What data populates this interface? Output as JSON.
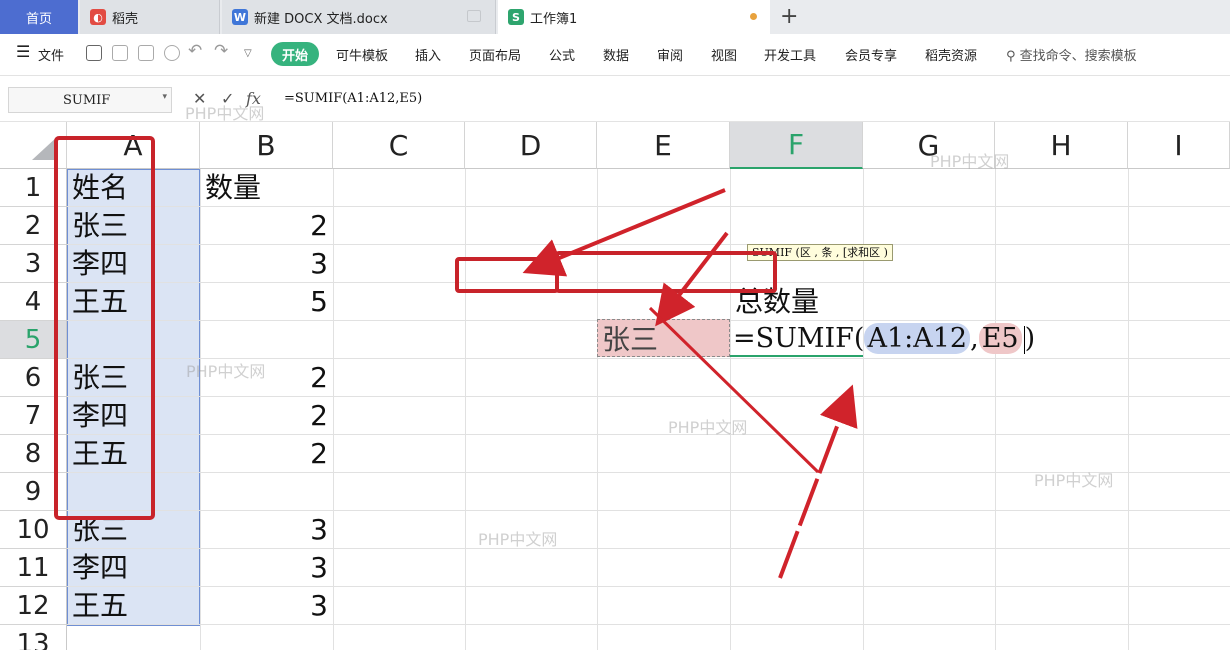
{
  "tabs": {
    "home": "首页",
    "daoke": "稻壳",
    "doc": "新建 DOCX 文档.docx",
    "workbook": "工作簿1"
  },
  "menu": {
    "file": "文件",
    "start": "开始",
    "items": [
      "可牛模板",
      "插入",
      "页面布局",
      "公式",
      "数据",
      "审阅",
      "视图",
      "开发工具",
      "会员专享",
      "稻壳资源"
    ],
    "search": "查找命令、搜索模板"
  },
  "formula": {
    "name_box": "SUMIF",
    "fx": "fx",
    "cancel": "✕",
    "confirm": "✓",
    "content": "=SUMIF(A1:A12,E5)"
  },
  "columns": [
    "A",
    "B",
    "C",
    "D",
    "E",
    "F",
    "G",
    "H",
    "I"
  ],
  "rows": [
    "1",
    "2",
    "3",
    "4",
    "5",
    "6",
    "7",
    "8",
    "9",
    "10",
    "11",
    "12",
    "13"
  ],
  "cells": {
    "A1": "姓名",
    "B1": "数量",
    "A2": "张三",
    "B2": "2",
    "A3": "李四",
    "B3": "3",
    "A4": "王五",
    "B4": "5",
    "A6": "张三",
    "B6": "2",
    "A7": "李四",
    "B7": "2",
    "A8": "王五",
    "B8": "2",
    "A10": "张三",
    "B10": "3",
    "A11": "李四",
    "B11": "3",
    "A12": "王五",
    "B12": "3",
    "F4": "总数量",
    "E5": "张三"
  },
  "editing": {
    "prefix": "=SUMIF(",
    "range": "A1:A12",
    "sep": ",",
    "criteria": "E5",
    "suffix": ")"
  },
  "tooltip": "SUMIF (区 , 条 , [求和区 )",
  "watermark": "PHP中文网",
  "colors": {
    "accent_green": "#2aa36b",
    "annotation_red": "#d0232b",
    "selection_blue": "#dbe4f4",
    "criteria_pink": "#efc7c8"
  }
}
